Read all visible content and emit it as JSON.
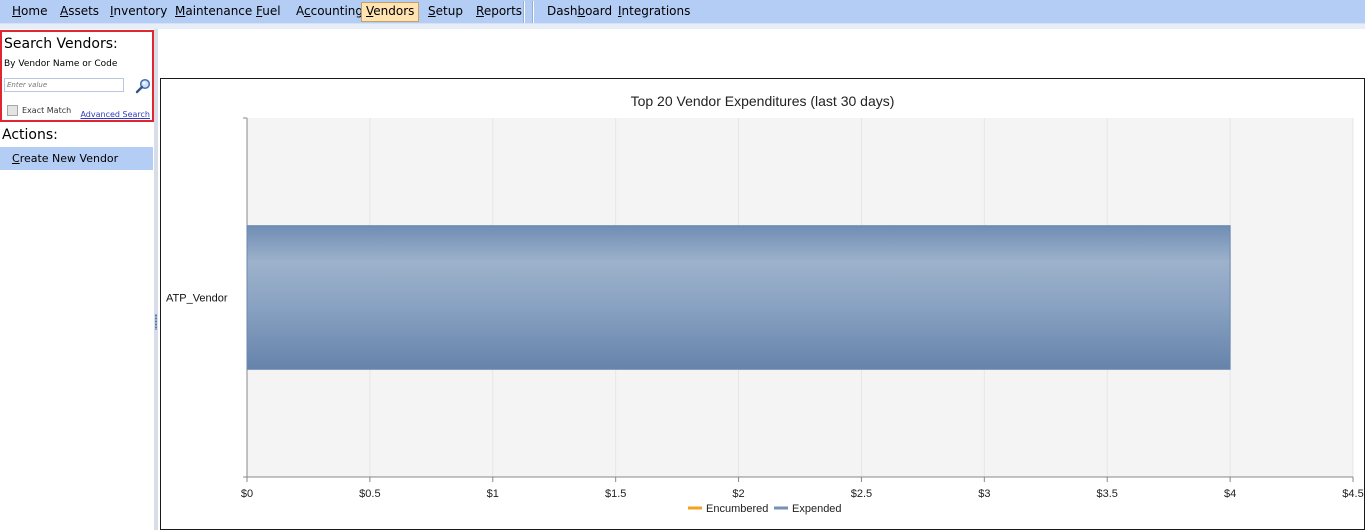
{
  "menu": {
    "items": [
      {
        "name": "home",
        "pre": "",
        "acc": "H",
        "post": "ome"
      },
      {
        "name": "assets",
        "pre": "",
        "acc": "A",
        "post": "ssets"
      },
      {
        "name": "inventory",
        "pre": "",
        "acc": "I",
        "post": "nventory"
      },
      {
        "name": "maintenance",
        "pre": "",
        "acc": "M",
        "post": "aintenance"
      },
      {
        "name": "fuel",
        "pre": "",
        "acc": "F",
        "post": "uel"
      },
      {
        "name": "accounting",
        "pre": "A",
        "acc": "c",
        "post": "counting"
      },
      {
        "name": "vendors",
        "pre": "",
        "acc": "V",
        "post": "endors"
      },
      {
        "name": "setup",
        "pre": "",
        "acc": "S",
        "post": "etup"
      },
      {
        "name": "reports",
        "pre": "",
        "acc": "R",
        "post": "eports"
      },
      {
        "name": "dashboard",
        "pre": "Dash",
        "acc": "b",
        "post": "oard"
      },
      {
        "name": "integrations",
        "pre": "",
        "acc": "I",
        "post": "ntegrations"
      }
    ],
    "active": "vendors"
  },
  "search": {
    "title": "Search Vendors:",
    "subtitle": "By Vendor Name or Code",
    "placeholder": "Enter value",
    "exact_match_label": "Exact Match",
    "advanced_search_label": "Advanced Search",
    "button_icon": "search-icon"
  },
  "actions": {
    "title": "Actions:",
    "create_pre": "",
    "create_acc": "C",
    "create_post": "reate New Vendor"
  },
  "chart_data": {
    "type": "bar",
    "orientation": "horizontal",
    "title": "Top 20 Vendor Expenditures (last 30 days)",
    "categories": [
      "ATP_Vendor"
    ],
    "series": [
      {
        "name": "Encumbered",
        "values": [
          0
        ],
        "color": "#f5a21d"
      },
      {
        "name": "Expended",
        "values": [
          4
        ],
        "color": "#7592b6"
      }
    ],
    "x_ticks": [
      "$0",
      "$0.5",
      "$1",
      "$1.5",
      "$2",
      "$2.5",
      "$3",
      "$3.5",
      "$4",
      "$4.5"
    ],
    "xlim": [
      0,
      4.5
    ],
    "xlabel": "",
    "ylabel": "",
    "grid": true,
    "legend": "bottom-center"
  }
}
